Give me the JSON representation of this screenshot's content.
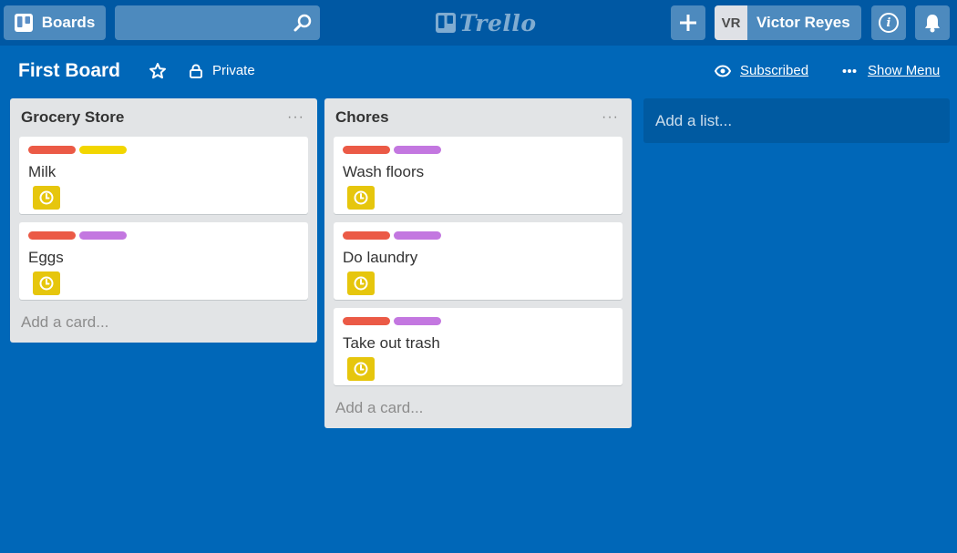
{
  "header": {
    "boards_label": "Boards",
    "search_value": "",
    "logo_text": "Trello",
    "add_label": "+",
    "member_initials": "VR",
    "member_name": "Victor Reyes"
  },
  "board": {
    "title": "First Board",
    "privacy": "Private",
    "subscribed": "Subscribed",
    "menu": "Show Menu"
  },
  "colors": {
    "red": "#eb5a46",
    "yellow": "#f2d600",
    "purple": "#c377e0",
    "due": "#e6c60d"
  },
  "lists": [
    {
      "title": "Grocery Store",
      "menu": "···",
      "cards": [
        {
          "title": "Milk",
          "labels": [
            "red",
            "yellow"
          ]
        },
        {
          "title": "Eggs",
          "labels": [
            "red",
            "purple"
          ]
        }
      ],
      "add_card": "Add a card..."
    },
    {
      "title": "Chores",
      "menu": "···",
      "cards": [
        {
          "title": "Wash floors",
          "labels": [
            "red",
            "purple"
          ]
        },
        {
          "title": "Do laundry",
          "labels": [
            "red",
            "purple"
          ]
        },
        {
          "title": "Take out trash",
          "labels": [
            "red",
            "purple"
          ]
        }
      ],
      "add_card": "Add a card..."
    }
  ],
  "add_list": "Add a list..."
}
